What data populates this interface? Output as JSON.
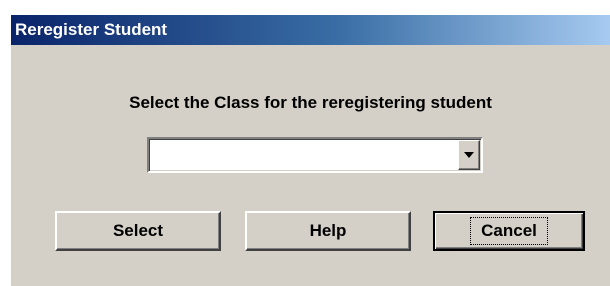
{
  "window": {
    "title": "Reregister Student"
  },
  "dialog": {
    "prompt": "Select the Class for the reregistering student",
    "class_select": {
      "value": ""
    },
    "buttons": {
      "select_label": "Select",
      "help_label": "Help",
      "cancel_label": "Cancel"
    }
  },
  "colors": {
    "titlebar_start": "#0a246a",
    "titlebar_end": "#a6caf0",
    "dialog_face": "#d4d0c8"
  },
  "icons": {
    "dropdown": "chevron-down-icon"
  }
}
